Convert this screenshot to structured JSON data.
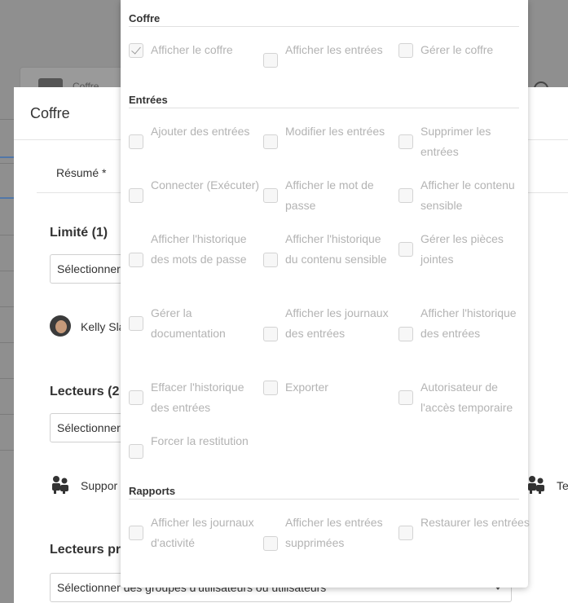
{
  "background": {
    "card_label": "Coffre"
  },
  "modal": {
    "title": "Coffre",
    "tab_summary": "Résumé *",
    "sections": {
      "limited": "Limité (1)",
      "readers": "Lecteurs (2",
      "readers_pro": "Lecteurs pr"
    },
    "select_placeholder_short": "Sélectionner",
    "select_placeholder_full": "Sélectionner des groupes d'utilisateurs ou utilisateurs",
    "limited_user": "Kelly Sla",
    "reader_group_left": "Suppor",
    "reader_group_right": "Te"
  },
  "panel": {
    "headings": {
      "vault": "Coffre",
      "entries": "Entrées",
      "reports": "Rapports"
    },
    "vault_perms": [
      {
        "label": "Afficher le coffre",
        "checked": true
      },
      {
        "label": "Afficher les entrées",
        "checked": false
      },
      {
        "label": "Gérer le coffre",
        "checked": false
      }
    ],
    "entry_perms": [
      {
        "label": "Ajouter des entrées",
        "checked": false
      },
      {
        "label": "Modifier les entrées",
        "checked": false
      },
      {
        "label": "Supprimer les entrées",
        "checked": false
      },
      {
        "label": "Connecter (Exécuter)",
        "checked": false
      },
      {
        "label": "Afficher le mot de passe",
        "checked": false
      },
      {
        "label": "Afficher le contenu sensible",
        "checked": false
      },
      {
        "label": "Afficher l'historique des mots de passe",
        "checked": false
      },
      {
        "label": "Afficher l'historique du contenu sensible",
        "checked": false
      },
      {
        "label": "Gérer les pièces jointes",
        "checked": false
      },
      {
        "label": "Gérer la documentation",
        "checked": false
      },
      {
        "label": "Afficher les journaux des entrées",
        "checked": false
      },
      {
        "label": "Afficher l'historique des entrées",
        "checked": false
      },
      {
        "label": "Effacer l'historique des entrées",
        "checked": false
      },
      {
        "label": "Exporter",
        "checked": false
      },
      {
        "label": "Autorisateur de l'accès temporaire",
        "checked": false
      },
      {
        "label": "Forcer la restitution",
        "checked": false
      }
    ],
    "report_perms": [
      {
        "label": "Afficher les journaux d'activité",
        "checked": false
      },
      {
        "label": "Afficher les entrées supprimées",
        "checked": false
      },
      {
        "label": "Restaurer les entrées",
        "checked": false
      }
    ]
  }
}
